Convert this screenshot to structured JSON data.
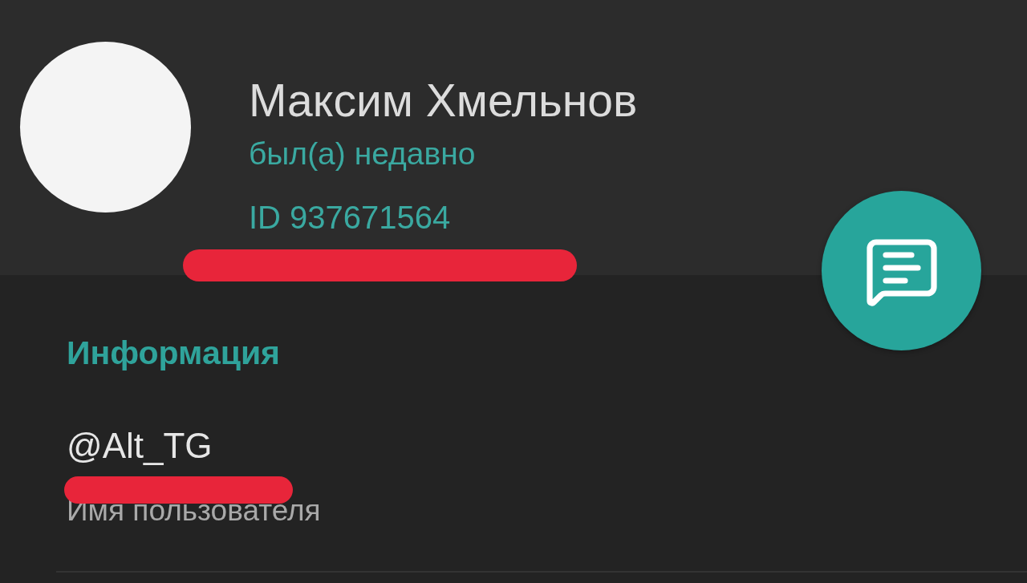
{
  "profile": {
    "name": "Максим Хмельнов",
    "status": "был(а) недавно",
    "id": {
      "text": "ID 937671564",
      "marked": true
    }
  },
  "info": {
    "heading": "Информация",
    "username": {
      "value": "@Alt_TG",
      "label": "Имя пользователя",
      "marked": true
    }
  }
}
